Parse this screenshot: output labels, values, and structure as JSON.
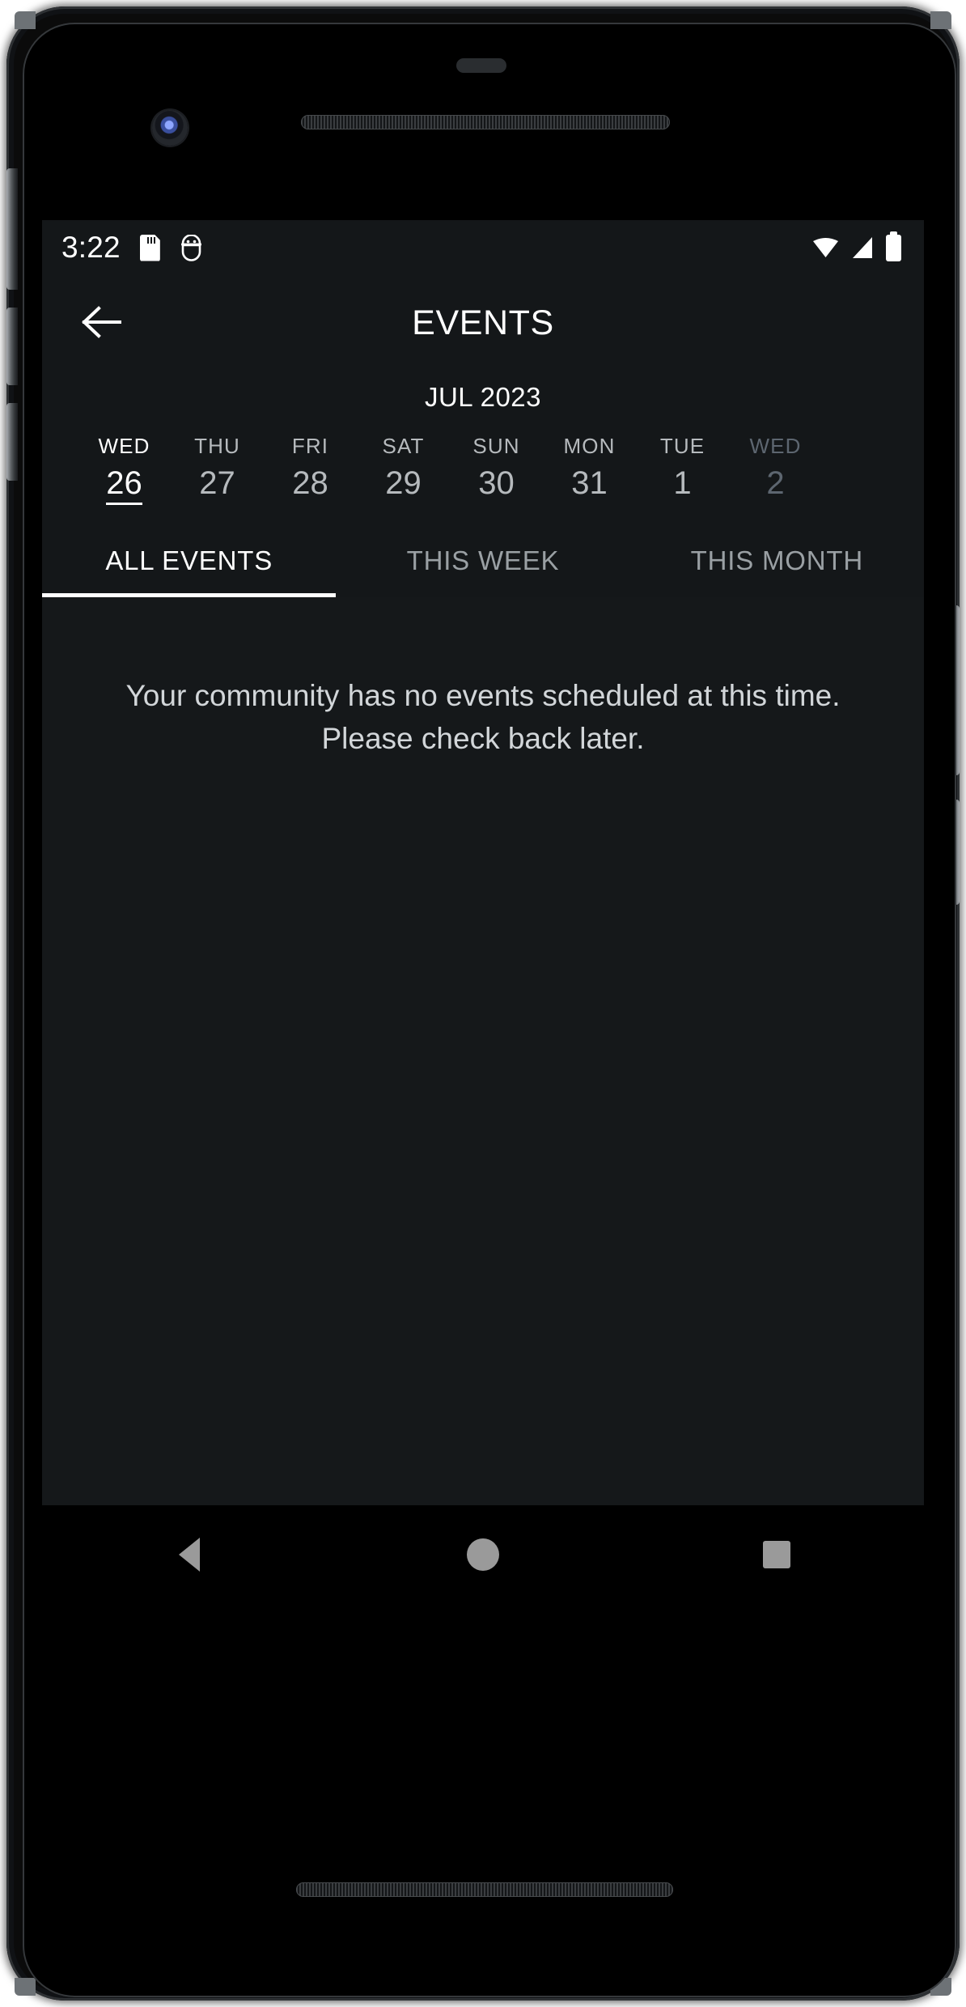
{
  "status_bar": {
    "time": "3:22",
    "left_icons": [
      "sdcard-icon",
      "android-debug-icon"
    ],
    "right_icons": [
      "wifi-icon",
      "cellular-signal-icon",
      "battery-icon"
    ]
  },
  "app_bar": {
    "back_icon": "arrow-left-icon",
    "title": "EVENTS"
  },
  "calendar": {
    "month_label": "JUL 2023",
    "days": [
      {
        "dow": "WED",
        "num": "26",
        "state": "selected"
      },
      {
        "dow": "THU",
        "num": "27",
        "state": "normal"
      },
      {
        "dow": "FRI",
        "num": "28",
        "state": "normal"
      },
      {
        "dow": "SAT",
        "num": "29",
        "state": "normal"
      },
      {
        "dow": "SUN",
        "num": "30",
        "state": "normal"
      },
      {
        "dow": "MON",
        "num": "31",
        "state": "normal"
      },
      {
        "dow": "TUE",
        "num": "1",
        "state": "normal"
      },
      {
        "dow": "WED",
        "num": "2",
        "state": "dim"
      }
    ]
  },
  "tabs": [
    {
      "label": "ALL EVENTS",
      "active": true
    },
    {
      "label": "THIS WEEK",
      "active": false
    },
    {
      "label": "THIS MONTH",
      "active": false
    }
  ],
  "content": {
    "empty_message": "Your community has no events scheduled at this time. Please check back later."
  },
  "nav_bar": {
    "back": "nav-back-icon",
    "home": "nav-home-icon",
    "recents": "nav-recents-icon"
  },
  "colors": {
    "screen_bg": "#15181a",
    "chrome_bg": "#141719",
    "accent": "#ffffff",
    "muted_text": "#b6babd",
    "dim_text": "#5d6670",
    "nav_icon": "#9a9a9a"
  }
}
